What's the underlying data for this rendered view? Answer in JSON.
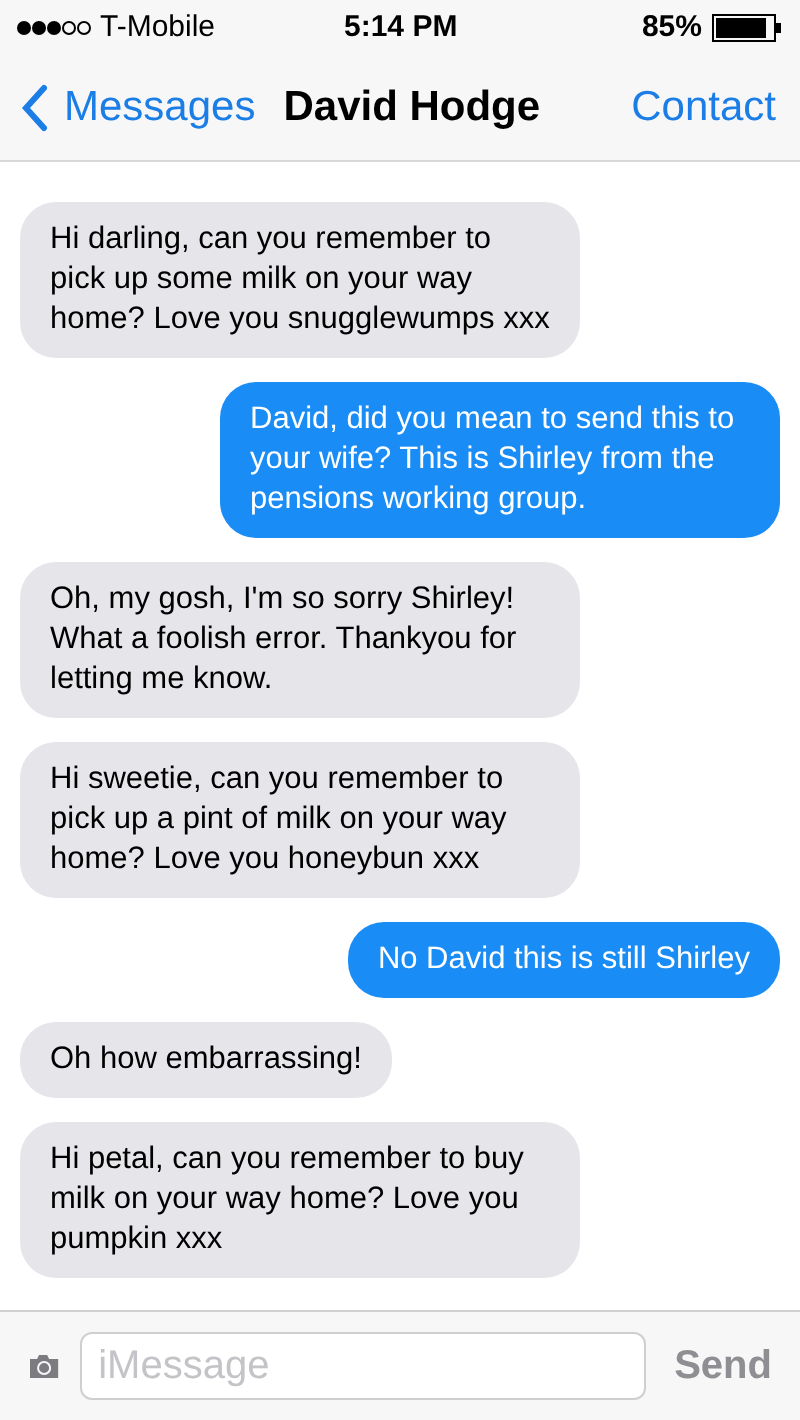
{
  "status_bar": {
    "carrier": "T-Mobile",
    "time": "5:14 PM",
    "battery": "85%"
  },
  "nav": {
    "back": "Messages",
    "title": "David Hodge",
    "action": "Contact"
  },
  "messages": [
    {
      "kind": "received",
      "text": "Hi darling, can you remember to pick up some milk on your way home? Love you snugglewumps xxx"
    },
    {
      "kind": "sent",
      "text": "David, did you mean to send this to your wife? This is Shirley from the pensions working group."
    },
    {
      "kind": "received",
      "text": "Oh, my gosh, I'm so sorry Shirley! What a foolish error. Thankyou for letting me know."
    },
    {
      "kind": "received",
      "text": "Hi sweetie, can you remember to pick up a pint of milk on your way home? Love you honeybun xxx"
    },
    {
      "kind": "sent",
      "text": "No David this is still Shirley"
    },
    {
      "kind": "received",
      "text": "Oh how embarrassing!"
    },
    {
      "kind": "received",
      "text": "Hi petal, can you remember to buy milk on your way home? Love you pumpkin xxx"
    }
  ],
  "composer": {
    "placeholder": "iMessage",
    "send": "Send"
  }
}
